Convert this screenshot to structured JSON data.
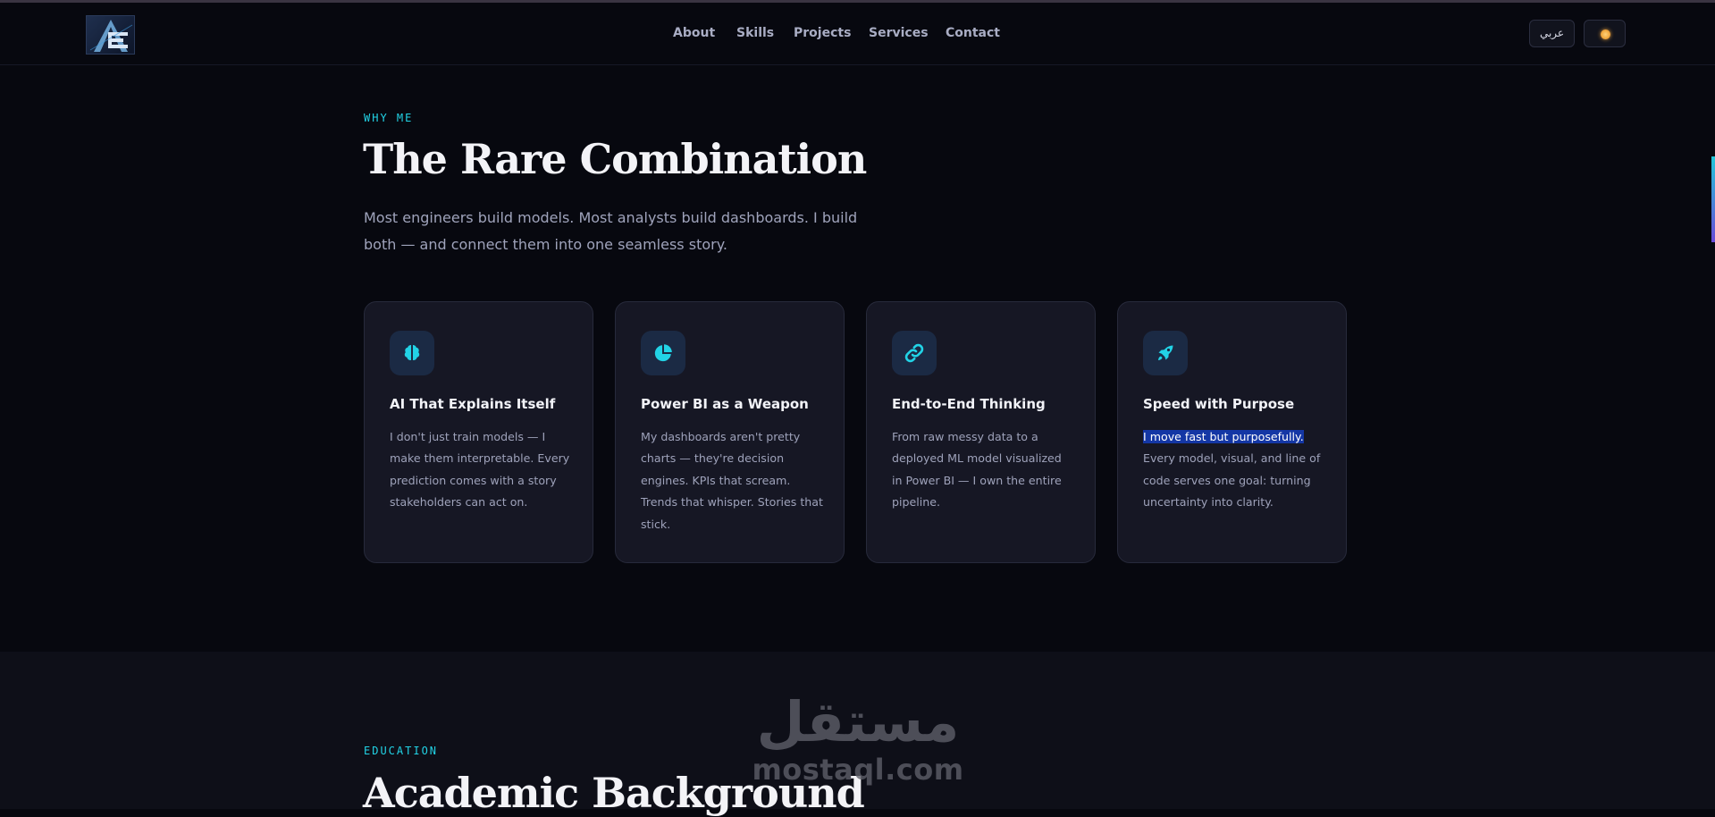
{
  "header": {
    "nav": [
      {
        "label": "About"
      },
      {
        "label": "Skills"
      },
      {
        "label": "Projects"
      },
      {
        "label": "Services"
      },
      {
        "label": "Contact"
      }
    ],
    "lang_label": "عربي",
    "theme_icon": "sun-icon"
  },
  "why": {
    "eyebrow": "WHY ME",
    "title": "The Rare Combination",
    "intro": "Most engineers build models. Most analysts build dashboards. I build both — and connect them into one seamless story.",
    "cards": [
      {
        "icon": "brain-icon",
        "title": "AI That Explains Itself",
        "body": "I don't just train models — I make them interpretable. Every prediction comes with a story stakeholders can act on."
      },
      {
        "icon": "pie-chart-icon",
        "title": "Power BI as a Weapon",
        "body": "My dashboards aren't pretty charts — they're decision engines. KPIs that scream. Trends that whisper. Stories that stick."
      },
      {
        "icon": "link-icon",
        "title": "End-to-End Thinking",
        "body": "From raw messy data to a deployed ML model visualized in Power BI — I own the entire pipeline."
      },
      {
        "icon": "rocket-icon",
        "title": "Speed with Purpose",
        "highlight": "I move fast but purposefully.",
        "body": "Every model, visual, and line of code serves one goal: turning uncertainty into clarity."
      }
    ]
  },
  "education": {
    "eyebrow": "EDUCATION",
    "title": "Academic Background"
  },
  "watermark": {
    "arabic": "مستقل",
    "latin": "mostaql.com"
  },
  "colors": {
    "accent": "#22d3e6",
    "background": "#07080f",
    "card": "#161724",
    "highlight": "#1437a5"
  }
}
